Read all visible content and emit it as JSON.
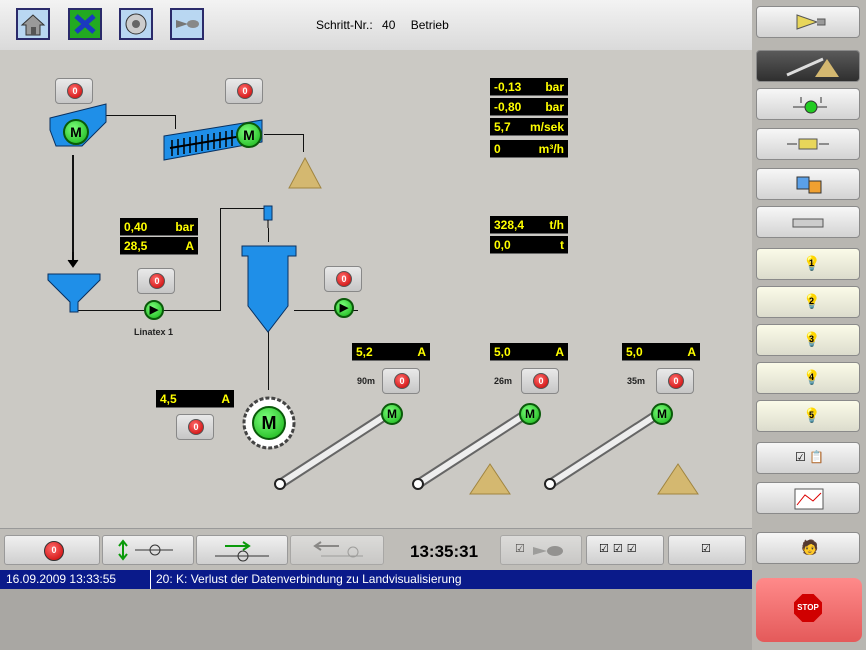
{
  "header": {
    "step_label": "Schritt-Nr.:",
    "step_number": "40",
    "mode": "Betrieb"
  },
  "top_buttons": [
    {
      "icon": "home-icon"
    },
    {
      "icon": "cross-tools-icon"
    },
    {
      "icon": "disc-icon"
    },
    {
      "icon": "nozzle-icon"
    }
  ],
  "displays": {
    "pressure1": {
      "value": "-0,13",
      "unit": "bar"
    },
    "pressure2": {
      "value": "-0,80",
      "unit": "bar"
    },
    "velocity": {
      "value": "5,7",
      "unit": "m/sek"
    },
    "flow": {
      "value": "0",
      "unit": "m³/h"
    },
    "pump_pressure": {
      "value": "0,40",
      "unit": "bar"
    },
    "pump_current": {
      "value": "28,5",
      "unit": "A"
    },
    "throughput": {
      "value": "328,4",
      "unit": "t/h"
    },
    "total": {
      "value": "0,0",
      "unit": "t"
    },
    "thickener_current": {
      "value": "4,5",
      "unit": "A"
    },
    "conv1_current": {
      "value": "5,2",
      "unit": "A"
    },
    "conv2_current": {
      "value": "5,0",
      "unit": "A"
    },
    "conv3_current": {
      "value": "5,0",
      "unit": "A"
    }
  },
  "labels": {
    "pump": "Linatex 1",
    "conv1_len": "90m",
    "conv2_len": "26m",
    "conv3_len": "35m",
    "motor": "M",
    "stop": "0"
  },
  "bottom": {
    "time": "13:35:31"
  },
  "message": {
    "timestamp": "16.09.2009 13:33:55",
    "text": "20: K: Verlust der Datenverbindung zu Landvisualisierung"
  },
  "right_panel": {
    "lamps": [
      "1",
      "2",
      "3",
      "4",
      "5"
    ],
    "stop_label": "STOP"
  },
  "colors": {
    "display_text": "#ffff00",
    "motor": "#22cc22",
    "equipment": "#1f8fe8",
    "message_bar": "#0a1a8a",
    "stop": "#d00000"
  }
}
